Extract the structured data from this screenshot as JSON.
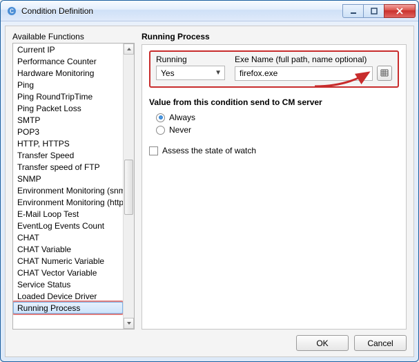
{
  "window": {
    "title": "Condition Definition"
  },
  "left": {
    "heading": "Available Functions",
    "items": [
      "Current IP",
      "Performance Counter",
      "Hardware Monitoring",
      "Ping",
      "Ping RoundTripTime",
      "Ping Packet Loss",
      "SMTP",
      "POP3",
      "HTTP, HTTPS",
      "Transfer Speed",
      "Transfer speed of FTP",
      "SNMP",
      "Environment Monitoring (snmp)",
      "Environment Monitoring (http)",
      "E-Mail Loop Test",
      "EventLog Events Count",
      "CHAT",
      "CHAT Variable",
      "CHAT Numeric Variable",
      "CHAT Vector Variable",
      "Service Status",
      "Loaded Device Driver",
      "Running Process"
    ],
    "selected_index": 22
  },
  "right": {
    "heading": "Running Process",
    "running": {
      "label": "Running",
      "value": "Yes"
    },
    "exe": {
      "label": "Exe Name (full path, name optional)",
      "value": "firefox.exe"
    },
    "value_group": {
      "title": "Value from this condition send to CM server",
      "options": [
        {
          "label": "Always",
          "checked": true
        },
        {
          "label": "Never",
          "checked": false
        }
      ]
    },
    "assess": {
      "label": "Assess the state of watch",
      "checked": false
    }
  },
  "footer": {
    "ok": "OK",
    "cancel": "Cancel"
  }
}
